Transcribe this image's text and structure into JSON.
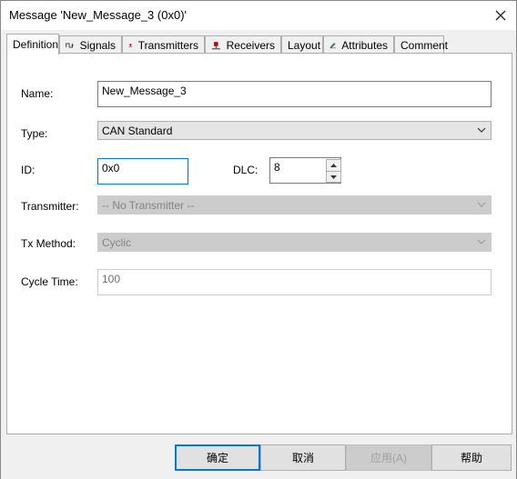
{
  "window": {
    "title": "Message 'New_Message_3 (0x0)'"
  },
  "tabs": [
    {
      "label": "Definition",
      "icon": "none",
      "active": true
    },
    {
      "label": "Signals",
      "icon": "signals-icon"
    },
    {
      "label": "Transmitters",
      "icon": "transmitter-icon"
    },
    {
      "label": "Receivers",
      "icon": "receiver-icon"
    },
    {
      "label": "Layout",
      "icon": "none"
    },
    {
      "label": "Attributes",
      "icon": "pencil-icon"
    },
    {
      "label": "Comment",
      "icon": "none"
    }
  ],
  "form": {
    "name_label": "Name:",
    "name_value": "New_Message_3",
    "type_label": "Type:",
    "type_value": "CAN Standard",
    "id_label": "ID:",
    "id_value": "0x0",
    "dlc_label": "DLC:",
    "dlc_value": "8",
    "transmitter_label": "Transmitter:",
    "transmitter_value": "-- No Transmitter --",
    "tx_method_label": "Tx Method:",
    "tx_method_value": "Cyclic",
    "cycle_time_label": "Cycle Time:",
    "cycle_time_value": "100"
  },
  "buttons": {
    "ok": "确定",
    "cancel": "取消",
    "apply": "应用(A)",
    "help": "帮助"
  },
  "colors": {
    "focus": "#0078d7",
    "accent_icon": "#c00000"
  }
}
